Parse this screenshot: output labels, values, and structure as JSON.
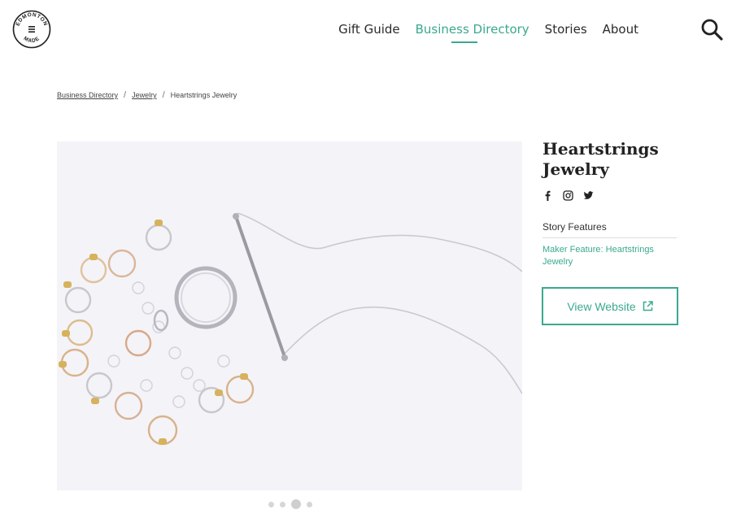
{
  "brand": {
    "logo_text": "EDMONTON MADE",
    "accent_color": "#3aa98f"
  },
  "nav": {
    "items": [
      {
        "label": "Gift Guide",
        "active": false
      },
      {
        "label": "Business Directory",
        "active": true
      },
      {
        "label": "Stories",
        "active": false
      },
      {
        "label": "About",
        "active": false
      }
    ],
    "search_icon": "search-icon"
  },
  "breadcrumb": {
    "items": [
      "Business Directory",
      "Jewelry",
      "Heartstrings Jewelry"
    ],
    "separator": "/"
  },
  "business": {
    "name": "Heartstrings Jewelry",
    "socials": [
      "facebook-icon",
      "instagram-icon",
      "twitter-icon"
    ],
    "story_heading": "Story Features",
    "story_link": "Maker Feature: Heartstrings Jewelry",
    "website_label": "View Website"
  },
  "gallery": {
    "slide_count": 4,
    "active_slide": 3
  }
}
